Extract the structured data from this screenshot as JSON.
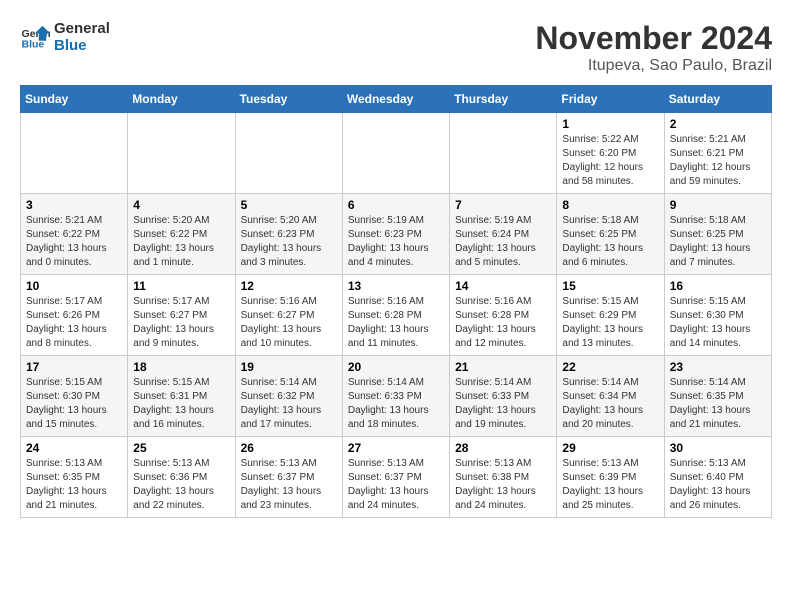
{
  "logo": {
    "line1": "General",
    "line2": "Blue"
  },
  "title": "November 2024",
  "subtitle": "Itupeva, Sao Paulo, Brazil",
  "days_of_week": [
    "Sunday",
    "Monday",
    "Tuesday",
    "Wednesday",
    "Thursday",
    "Friday",
    "Saturday"
  ],
  "weeks": [
    [
      {
        "day": "",
        "info": ""
      },
      {
        "day": "",
        "info": ""
      },
      {
        "day": "",
        "info": ""
      },
      {
        "day": "",
        "info": ""
      },
      {
        "day": "",
        "info": ""
      },
      {
        "day": "1",
        "info": "Sunrise: 5:22 AM\nSunset: 6:20 PM\nDaylight: 12 hours and 58 minutes."
      },
      {
        "day": "2",
        "info": "Sunrise: 5:21 AM\nSunset: 6:21 PM\nDaylight: 12 hours and 59 minutes."
      }
    ],
    [
      {
        "day": "3",
        "info": "Sunrise: 5:21 AM\nSunset: 6:22 PM\nDaylight: 13 hours and 0 minutes."
      },
      {
        "day": "4",
        "info": "Sunrise: 5:20 AM\nSunset: 6:22 PM\nDaylight: 13 hours and 1 minute."
      },
      {
        "day": "5",
        "info": "Sunrise: 5:20 AM\nSunset: 6:23 PM\nDaylight: 13 hours and 3 minutes."
      },
      {
        "day": "6",
        "info": "Sunrise: 5:19 AM\nSunset: 6:23 PM\nDaylight: 13 hours and 4 minutes."
      },
      {
        "day": "7",
        "info": "Sunrise: 5:19 AM\nSunset: 6:24 PM\nDaylight: 13 hours and 5 minutes."
      },
      {
        "day": "8",
        "info": "Sunrise: 5:18 AM\nSunset: 6:25 PM\nDaylight: 13 hours and 6 minutes."
      },
      {
        "day": "9",
        "info": "Sunrise: 5:18 AM\nSunset: 6:25 PM\nDaylight: 13 hours and 7 minutes."
      }
    ],
    [
      {
        "day": "10",
        "info": "Sunrise: 5:17 AM\nSunset: 6:26 PM\nDaylight: 13 hours and 8 minutes."
      },
      {
        "day": "11",
        "info": "Sunrise: 5:17 AM\nSunset: 6:27 PM\nDaylight: 13 hours and 9 minutes."
      },
      {
        "day": "12",
        "info": "Sunrise: 5:16 AM\nSunset: 6:27 PM\nDaylight: 13 hours and 10 minutes."
      },
      {
        "day": "13",
        "info": "Sunrise: 5:16 AM\nSunset: 6:28 PM\nDaylight: 13 hours and 11 minutes."
      },
      {
        "day": "14",
        "info": "Sunrise: 5:16 AM\nSunset: 6:28 PM\nDaylight: 13 hours and 12 minutes."
      },
      {
        "day": "15",
        "info": "Sunrise: 5:15 AM\nSunset: 6:29 PM\nDaylight: 13 hours and 13 minutes."
      },
      {
        "day": "16",
        "info": "Sunrise: 5:15 AM\nSunset: 6:30 PM\nDaylight: 13 hours and 14 minutes."
      }
    ],
    [
      {
        "day": "17",
        "info": "Sunrise: 5:15 AM\nSunset: 6:30 PM\nDaylight: 13 hours and 15 minutes."
      },
      {
        "day": "18",
        "info": "Sunrise: 5:15 AM\nSunset: 6:31 PM\nDaylight: 13 hours and 16 minutes."
      },
      {
        "day": "19",
        "info": "Sunrise: 5:14 AM\nSunset: 6:32 PM\nDaylight: 13 hours and 17 minutes."
      },
      {
        "day": "20",
        "info": "Sunrise: 5:14 AM\nSunset: 6:33 PM\nDaylight: 13 hours and 18 minutes."
      },
      {
        "day": "21",
        "info": "Sunrise: 5:14 AM\nSunset: 6:33 PM\nDaylight: 13 hours and 19 minutes."
      },
      {
        "day": "22",
        "info": "Sunrise: 5:14 AM\nSunset: 6:34 PM\nDaylight: 13 hours and 20 minutes."
      },
      {
        "day": "23",
        "info": "Sunrise: 5:14 AM\nSunset: 6:35 PM\nDaylight: 13 hours and 21 minutes."
      }
    ],
    [
      {
        "day": "24",
        "info": "Sunrise: 5:13 AM\nSunset: 6:35 PM\nDaylight: 13 hours and 21 minutes."
      },
      {
        "day": "25",
        "info": "Sunrise: 5:13 AM\nSunset: 6:36 PM\nDaylight: 13 hours and 22 minutes."
      },
      {
        "day": "26",
        "info": "Sunrise: 5:13 AM\nSunset: 6:37 PM\nDaylight: 13 hours and 23 minutes."
      },
      {
        "day": "27",
        "info": "Sunrise: 5:13 AM\nSunset: 6:37 PM\nDaylight: 13 hours and 24 minutes."
      },
      {
        "day": "28",
        "info": "Sunrise: 5:13 AM\nSunset: 6:38 PM\nDaylight: 13 hours and 24 minutes."
      },
      {
        "day": "29",
        "info": "Sunrise: 5:13 AM\nSunset: 6:39 PM\nDaylight: 13 hours and 25 minutes."
      },
      {
        "day": "30",
        "info": "Sunrise: 5:13 AM\nSunset: 6:40 PM\nDaylight: 13 hours and 26 minutes."
      }
    ]
  ]
}
